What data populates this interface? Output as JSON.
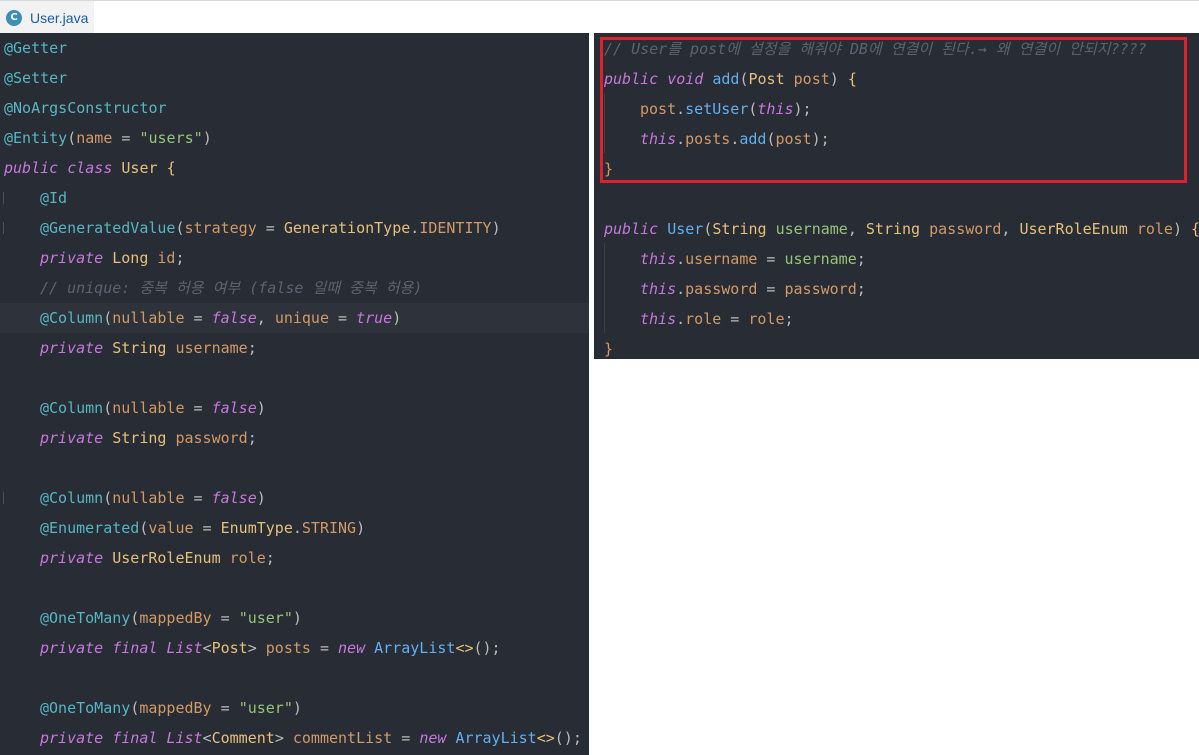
{
  "tab": {
    "icon": "C",
    "label": "User.java"
  },
  "left": {
    "lines": [
      {
        "indent": 0,
        "parts": [
          [
            "ann",
            "@Getter"
          ]
        ]
      },
      {
        "indent": 0,
        "parts": [
          [
            "ann",
            "@Setter"
          ]
        ]
      },
      {
        "indent": 0,
        "parts": [
          [
            "ann",
            "@NoArgsConstructor"
          ]
        ]
      },
      {
        "indent": 0,
        "parts": [
          [
            "ann",
            "@Entity"
          ],
          [
            "plain",
            "("
          ],
          [
            "param",
            "name"
          ],
          [
            "plain",
            " = "
          ],
          [
            "str",
            "\"users\""
          ],
          [
            "plain",
            ")"
          ]
        ]
      },
      {
        "indent": 0,
        "parts": [
          [
            "kw",
            "public class"
          ],
          [
            "plain",
            " "
          ],
          [
            "ty",
            "User"
          ],
          [
            "plain",
            " "
          ],
          [
            "brace",
            "{"
          ]
        ]
      },
      {
        "indent": 1,
        "parts": [
          [
            "ann",
            "@Id"
          ]
        ]
      },
      {
        "indent": 1,
        "parts": [
          [
            "ann",
            "@GeneratedValue"
          ],
          [
            "plain",
            "("
          ],
          [
            "param",
            "strategy"
          ],
          [
            "plain",
            " = "
          ],
          [
            "ty",
            "GenerationType"
          ],
          [
            "plain",
            "."
          ],
          [
            "field",
            "IDENTITY"
          ],
          [
            "plain",
            ")"
          ]
        ]
      },
      {
        "indent": 1,
        "parts": [
          [
            "kw",
            "private"
          ],
          [
            "plain",
            " "
          ],
          [
            "ty",
            "Long"
          ],
          [
            "plain",
            " "
          ],
          [
            "field",
            "id"
          ],
          [
            "plain",
            ";"
          ]
        ]
      },
      {
        "indent": 1,
        "parts": [
          [
            "cm",
            "// unique: 중복 허용 여부 (false 일때 중복 허용)"
          ]
        ]
      },
      {
        "indent": 1,
        "current": true,
        "parts": [
          [
            "ann",
            "@Column"
          ],
          [
            "plain",
            "("
          ],
          [
            "param",
            "nullable"
          ],
          [
            "plain",
            " = "
          ],
          [
            "kw",
            "false"
          ],
          [
            "plain",
            ", "
          ],
          [
            "param",
            "unique"
          ],
          [
            "plain",
            " = "
          ],
          [
            "kw",
            "true"
          ],
          [
            "plain",
            ")"
          ]
        ]
      },
      {
        "indent": 1,
        "parts": [
          [
            "kw",
            "private"
          ],
          [
            "plain",
            " "
          ],
          [
            "ty",
            "String"
          ],
          [
            "plain",
            " "
          ],
          [
            "field",
            "username"
          ],
          [
            "plain",
            ";"
          ]
        ]
      },
      {
        "indent": 0,
        "parts": []
      },
      {
        "indent": 1,
        "parts": [
          [
            "ann",
            "@Column"
          ],
          [
            "plain",
            "("
          ],
          [
            "param",
            "nullable"
          ],
          [
            "plain",
            " = "
          ],
          [
            "kw",
            "false"
          ],
          [
            "plain",
            ")"
          ]
        ]
      },
      {
        "indent": 1,
        "parts": [
          [
            "kw",
            "private"
          ],
          [
            "plain",
            " "
          ],
          [
            "ty",
            "String"
          ],
          [
            "plain",
            " "
          ],
          [
            "field",
            "password"
          ],
          [
            "plain",
            ";"
          ]
        ]
      },
      {
        "indent": 0,
        "parts": []
      },
      {
        "indent": 1,
        "parts": [
          [
            "ann",
            "@Column"
          ],
          [
            "plain",
            "("
          ],
          [
            "param",
            "nullable"
          ],
          [
            "plain",
            " = "
          ],
          [
            "kw",
            "false"
          ],
          [
            "plain",
            ")"
          ]
        ]
      },
      {
        "indent": 1,
        "parts": [
          [
            "ann",
            "@Enumerated"
          ],
          [
            "plain",
            "("
          ],
          [
            "param",
            "value"
          ],
          [
            "plain",
            " = "
          ],
          [
            "ty",
            "EnumType"
          ],
          [
            "plain",
            "."
          ],
          [
            "field",
            "STRING"
          ],
          [
            "plain",
            ")"
          ]
        ]
      },
      {
        "indent": 1,
        "parts": [
          [
            "kw",
            "private"
          ],
          [
            "plain",
            " "
          ],
          [
            "ty",
            "UserRoleEnum"
          ],
          [
            "plain",
            " "
          ],
          [
            "field",
            "role"
          ],
          [
            "plain",
            ";"
          ]
        ]
      },
      {
        "indent": 0,
        "parts": []
      },
      {
        "indent": 1,
        "parts": [
          [
            "ann",
            "@OneToMany"
          ],
          [
            "plain",
            "("
          ],
          [
            "param",
            "mappedBy"
          ],
          [
            "plain",
            " = "
          ],
          [
            "str",
            "\"user\""
          ],
          [
            "plain",
            ")"
          ]
        ]
      },
      {
        "indent": 1,
        "parts": [
          [
            "kw",
            "private final"
          ],
          [
            "plain",
            " "
          ],
          [
            "kw",
            "List"
          ],
          [
            "plain",
            "<"
          ],
          [
            "ty",
            "Post"
          ],
          [
            "plain",
            "> "
          ],
          [
            "field",
            "posts"
          ],
          [
            "plain",
            " = "
          ],
          [
            "kw",
            "new"
          ],
          [
            "plain",
            " "
          ],
          [
            "meth",
            "ArrayList"
          ],
          [
            "brace",
            "<>"
          ],
          [
            "plain",
            "();"
          ]
        ]
      },
      {
        "indent": 0,
        "parts": []
      },
      {
        "indent": 1,
        "parts": [
          [
            "ann",
            "@OneToMany"
          ],
          [
            "plain",
            "("
          ],
          [
            "param",
            "mappedBy"
          ],
          [
            "plain",
            " = "
          ],
          [
            "str",
            "\"user\""
          ],
          [
            "plain",
            ")"
          ]
        ]
      },
      {
        "indent": 1,
        "parts": [
          [
            "kw",
            "private final"
          ],
          [
            "plain",
            " "
          ],
          [
            "kw",
            "List"
          ],
          [
            "plain",
            "<"
          ],
          [
            "ty",
            "Comment"
          ],
          [
            "plain",
            "> "
          ],
          [
            "field",
            "commentList"
          ],
          [
            "plain",
            " = "
          ],
          [
            "kw",
            "new"
          ],
          [
            "plain",
            " "
          ],
          [
            "meth",
            "ArrayList"
          ],
          [
            "brace",
            "<>"
          ],
          [
            "plain",
            "();"
          ]
        ]
      }
    ]
  },
  "right": {
    "lines": [
      {
        "indent": 0,
        "parts": [
          [
            "cm",
            "// User를 post에 설정을 해줘야 DB에 연결이 된다.→ 왜 연결이 안되지????"
          ]
        ]
      },
      {
        "indent": 0,
        "parts": [
          [
            "kw",
            "public void"
          ],
          [
            "plain",
            " "
          ],
          [
            "meth",
            "add"
          ],
          [
            "plain",
            "("
          ],
          [
            "ty",
            "Post"
          ],
          [
            "plain",
            " "
          ],
          [
            "pv",
            "post"
          ],
          [
            "plain",
            ") "
          ],
          [
            "brace",
            "{"
          ]
        ]
      },
      {
        "indent": 1,
        "parts": [
          [
            "pv",
            "post"
          ],
          [
            "plain",
            "."
          ],
          [
            "meth",
            "setUser"
          ],
          [
            "plain",
            "("
          ],
          [
            "kw",
            "this"
          ],
          [
            "plain",
            ");"
          ]
        ]
      },
      {
        "indent": 1,
        "parts": [
          [
            "kw",
            "this"
          ],
          [
            "plain",
            "."
          ],
          [
            "field",
            "posts"
          ],
          [
            "plain",
            "."
          ],
          [
            "meth",
            "add"
          ],
          [
            "plain",
            "("
          ],
          [
            "pv",
            "post"
          ],
          [
            "plain",
            ");"
          ]
        ]
      },
      {
        "indent": 0,
        "parts": [
          [
            "field",
            "}"
          ]
        ]
      },
      {
        "indent": 0,
        "parts": []
      },
      {
        "indent": 0,
        "parts": [
          [
            "kw",
            "public"
          ],
          [
            "plain",
            " "
          ],
          [
            "meth",
            "User"
          ],
          [
            "plain",
            "("
          ],
          [
            "ty",
            "String"
          ],
          [
            "plain",
            " "
          ],
          [
            "str",
            "username"
          ],
          [
            "plain",
            ", "
          ],
          [
            "ty",
            "String"
          ],
          [
            "plain",
            " "
          ],
          [
            "pv",
            "password"
          ],
          [
            "plain",
            ", "
          ],
          [
            "ty",
            "UserRoleEnum"
          ],
          [
            "plain",
            " "
          ],
          [
            "pv",
            "role"
          ],
          [
            "plain",
            ") "
          ],
          [
            "brace",
            "{"
          ]
        ]
      },
      {
        "indent": 1,
        "parts": [
          [
            "kw",
            "this"
          ],
          [
            "plain",
            "."
          ],
          [
            "field",
            "username"
          ],
          [
            "plain",
            " = "
          ],
          [
            "str",
            "username"
          ],
          [
            "plain",
            ";"
          ]
        ]
      },
      {
        "indent": 1,
        "parts": [
          [
            "kw",
            "this"
          ],
          [
            "plain",
            "."
          ],
          [
            "field",
            "password"
          ],
          [
            "plain",
            " = "
          ],
          [
            "pv",
            "password"
          ],
          [
            "plain",
            ";"
          ]
        ]
      },
      {
        "indent": 1,
        "parts": [
          [
            "kw",
            "this"
          ],
          [
            "plain",
            "."
          ],
          [
            "field",
            "role"
          ],
          [
            "plain",
            " = "
          ],
          [
            "pv",
            "role"
          ],
          [
            "plain",
            ";"
          ]
        ]
      },
      {
        "indent": 0,
        "parts": [
          [
            "field",
            "}"
          ]
        ]
      }
    ]
  },
  "colors": {
    "editor_bg": "#282c34",
    "highlight_box": "#e0212b",
    "annotation": "#56b6c2",
    "keyword": "#c678dd",
    "type": "#e5c07b",
    "string": "#98c379",
    "field": "#d19a66",
    "comment": "#5c6370"
  }
}
